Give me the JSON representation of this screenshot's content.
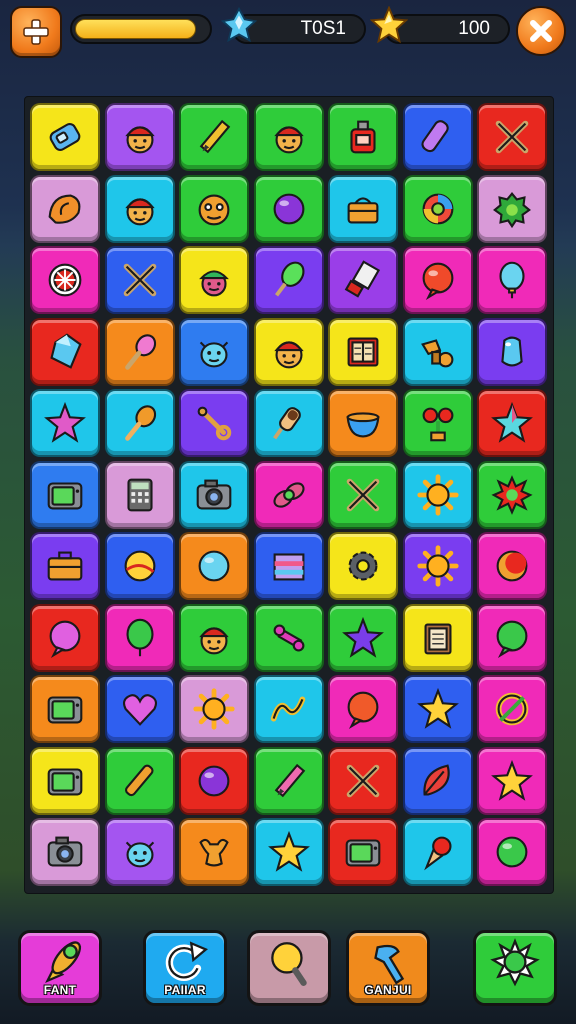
{
  "hud": {
    "energy_level": 0.92,
    "energy_color": "#f4c21f",
    "gems": {
      "icon": "blue-crystal-icon",
      "value": "T0S1"
    },
    "stars": {
      "icon": "star-icon",
      "value": "100"
    },
    "plus_icon": "plus-icon",
    "close_icon": "close-x-icon"
  },
  "board": {
    "rows": 11,
    "cols": 7,
    "tiles": [
      {
        "color": "#f5e51a",
        "icon": "blue-gadget-icon"
      },
      {
        "color": "#a455f0",
        "icon": "capped-face-icon"
      },
      {
        "color": "#2fcc3a",
        "icon": "pencil-icon"
      },
      {
        "color": "#2fcc3a",
        "icon": "capped-face-icon"
      },
      {
        "color": "#2fcc3a",
        "icon": "red-bottle-icon"
      },
      {
        "color": "#2f5ff0",
        "icon": "purple-tube-icon"
      },
      {
        "color": "#e8281f",
        "icon": "crossed-tools-icon"
      },
      {
        "color": "#d99ad8",
        "icon": "orange-shell-icon"
      },
      {
        "color": "#1fc6ea",
        "icon": "capped-face-icon"
      },
      {
        "color": "#2fcc3a",
        "icon": "orange-monster-icon"
      },
      {
        "color": "#2fcc3a",
        "icon": "purple-ball-icon"
      },
      {
        "color": "#1fc6ea",
        "icon": "orange-box-icon"
      },
      {
        "color": "#2fcc3a",
        "icon": "swirl-ball-icon"
      },
      {
        "color": "#d99ad8",
        "icon": "green-blob-icon"
      },
      {
        "color": "#f02ab8",
        "icon": "target-wheel-icon"
      },
      {
        "color": "#2f5ff0",
        "icon": "crossed-sticks-icon"
      },
      {
        "color": "#f5e51a",
        "icon": "green-hat-face-icon"
      },
      {
        "color": "#7a3df0",
        "icon": "green-pop-icon"
      },
      {
        "color": "#9a3ee8",
        "icon": "paper-tool-icon"
      },
      {
        "color": "#f02ab8",
        "icon": "red-bubble-icon"
      },
      {
        "color": "#f02ab8",
        "icon": "blue-balloon-icon"
      },
      {
        "color": "#e8281f",
        "icon": "blue-gem-icon"
      },
      {
        "color": "#f58a1c",
        "icon": "pink-spoon-icon"
      },
      {
        "color": "#2f7cf0",
        "icon": "blue-creature-icon"
      },
      {
        "color": "#f5e51a",
        "icon": "capped-face-icon"
      },
      {
        "color": "#f5e51a",
        "icon": "book-icon"
      },
      {
        "color": "#1fc6ea",
        "icon": "orange-pieces-icon"
      },
      {
        "color": "#7a3df0",
        "icon": "blue-bean-icon"
      },
      {
        "color": "#1fc6ea",
        "icon": "pink-star-icon"
      },
      {
        "color": "#1fc6ea",
        "icon": "orange-spoon-icon"
      },
      {
        "color": "#7a3df0",
        "icon": "wrench-icon"
      },
      {
        "color": "#1fc6ea",
        "icon": "ice-cream-icon"
      },
      {
        "color": "#f58a1c",
        "icon": "blue-bowl-icon"
      },
      {
        "color": "#2fcc3a",
        "icon": "red-plant-icon"
      },
      {
        "color": "#e8281f",
        "icon": "teal-star-icon"
      },
      {
        "color": "#2f7cf0",
        "icon": "tv-icon"
      },
      {
        "color": "#d99ad8",
        "icon": "calculator-icon"
      },
      {
        "color": "#1fc6ea",
        "icon": "camera-icon"
      },
      {
        "color": "#f02ab8",
        "icon": "green-knot-icon"
      },
      {
        "color": "#2fcc3a",
        "icon": "crossed-tools-icon"
      },
      {
        "color": "#1fc6ea",
        "icon": "sun-icon"
      },
      {
        "color": "#2fcc3a",
        "icon": "red-splat-icon"
      },
      {
        "color": "#7a3df0",
        "icon": "briefcase-icon"
      },
      {
        "color": "#2f5ff0",
        "icon": "yellow-ball-icon"
      },
      {
        "color": "#f58a1c",
        "icon": "blue-orb-icon"
      },
      {
        "color": "#2f5ff0",
        "icon": "striped-box-icon"
      },
      {
        "color": "#f5e51a",
        "icon": "gear-icon"
      },
      {
        "color": "#7a3df0",
        "icon": "sun-icon"
      },
      {
        "color": "#f02ab8",
        "icon": "orange-moon-ball-icon"
      },
      {
        "color": "#e8281f",
        "icon": "pink-bubble-icon"
      },
      {
        "color": "#f02ab8",
        "icon": "green-balloon-icon"
      },
      {
        "color": "#2fcc3a",
        "icon": "capped-face-icon"
      },
      {
        "color": "#2fcc3a",
        "icon": "pink-bone-icon"
      },
      {
        "color": "#2fcc3a",
        "icon": "purple-star-icon"
      },
      {
        "color": "#f5e51a",
        "icon": "clipboard-icon"
      },
      {
        "color": "#f02ab8",
        "icon": "green-bubble-icon"
      },
      {
        "color": "#f58a1c",
        "icon": "tv-icon"
      },
      {
        "color": "#2f5ff0",
        "icon": "heart-icon"
      },
      {
        "color": "#d99ad8",
        "icon": "sun-icon"
      },
      {
        "color": "#1fc6ea",
        "icon": "squiggle-icon"
      },
      {
        "color": "#f02ab8",
        "icon": "orange-bubble-icon"
      },
      {
        "color": "#2f5ff0",
        "icon": "yellow-star-icon"
      },
      {
        "color": "#f02ab8",
        "icon": "green-ring-icon"
      },
      {
        "color": "#f5e51a",
        "icon": "tv-icon"
      },
      {
        "color": "#2fcc3a",
        "icon": "orange-stick-icon"
      },
      {
        "color": "#e8281f",
        "icon": "purple-ball-icon"
      },
      {
        "color": "#2fcc3a",
        "icon": "pink-pencil-icon"
      },
      {
        "color": "#e8281f",
        "icon": "crossed-tools-icon"
      },
      {
        "color": "#2f5ff0",
        "icon": "red-leaf-icon"
      },
      {
        "color": "#f02ab8",
        "icon": "yellow-star-icon"
      },
      {
        "color": "#d99ad8",
        "icon": "camera-icon"
      },
      {
        "color": "#a455f0",
        "icon": "blue-creature-icon"
      },
      {
        "color": "#f58a1c",
        "icon": "orange-bone-icon"
      },
      {
        "color": "#1fc6ea",
        "icon": "yellow-star-icon"
      },
      {
        "color": "#e8281f",
        "icon": "tv-icon"
      },
      {
        "color": "#1fc6ea",
        "icon": "ice-cream-cone-icon"
      },
      {
        "color": "#f02ab8",
        "icon": "green-ball-icon"
      }
    ]
  },
  "tools": [
    {
      "label": "FANT",
      "color": "#e53cd8",
      "icon": "rocket-icon"
    },
    {
      "label": "PAIIAR",
      "color": "#1faaf0",
      "icon": "refresh-icon"
    },
    {
      "label": "",
      "color": "#c89aa8",
      "icon": "magnifier-icon"
    },
    {
      "label": "GANJUI",
      "color": "#f08a1c",
      "icon": "blue-hammer-icon"
    },
    {
      "label": "",
      "color": "#2fcc3a",
      "icon": "green-burst-icon"
    }
  ]
}
